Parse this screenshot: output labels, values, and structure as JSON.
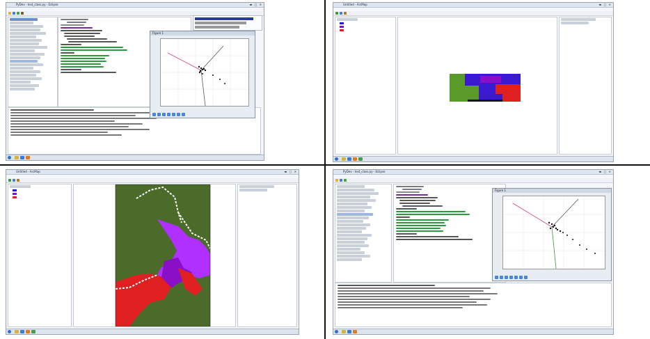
{
  "screens": {
    "top_left": {
      "app": "eclipse-pydev",
      "window_title": "PyDev - test_class.py - Eclipse"
    },
    "top_right": {
      "app": "arcgis-raster",
      "window_title": "Untitled - ArcMap"
    },
    "bottom_left": {
      "app": "arcgis-raster",
      "window_title": "Untitled - ArcMap"
    },
    "bottom_right": {
      "app": "eclipse-pydev",
      "window_title": "PyDev - test_class.py - Eclipse"
    }
  },
  "figure_window": {
    "title": "Figure 1"
  },
  "colors": {
    "forest": "#4a6b2a",
    "green": "#5aa02c",
    "blue": "#2a16d8",
    "purple": "#8a10c8",
    "violet": "#b030ff",
    "red": "#e02020",
    "white": "#ffffff"
  }
}
